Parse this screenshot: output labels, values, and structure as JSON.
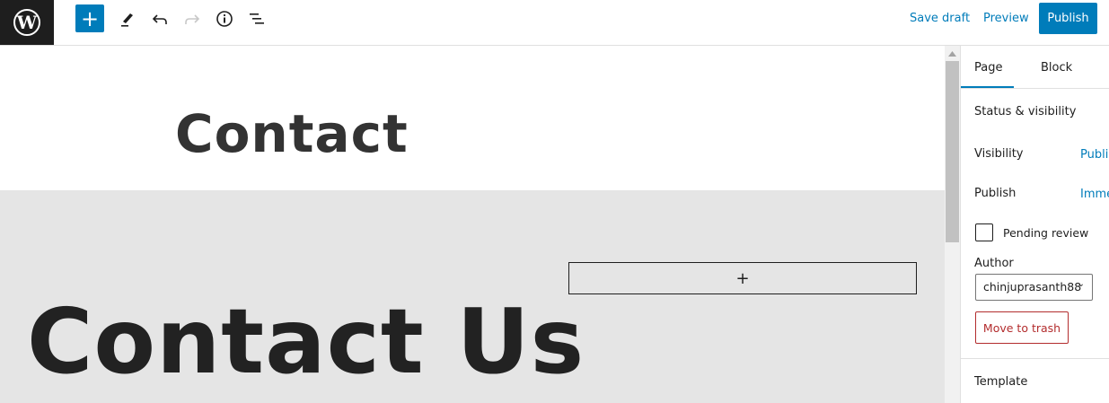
{
  "toolbar": {
    "save_draft": "Save draft",
    "preview": "Preview",
    "publish": "Publish",
    "add_icon": "plus-icon",
    "colors": {
      "accent": "#007cba"
    }
  },
  "editor": {
    "page_title": "Contact",
    "cover_heading": "Contact Us",
    "appender": "+"
  },
  "sidebar": {
    "tabs": [
      {
        "label": "Page",
        "active": true
      },
      {
        "label": "Block",
        "active": false
      }
    ],
    "status_section": "Status & visibility",
    "visibility_label": "Visibility",
    "visibility_value": "Public",
    "publish_label": "Publish",
    "publish_value": "Immediately",
    "pending_review": "Pending review",
    "pending_checked": false,
    "author_label": "Author",
    "author_value": "chinjuprasanth88",
    "trash": "Move to trash",
    "template": "Template"
  }
}
